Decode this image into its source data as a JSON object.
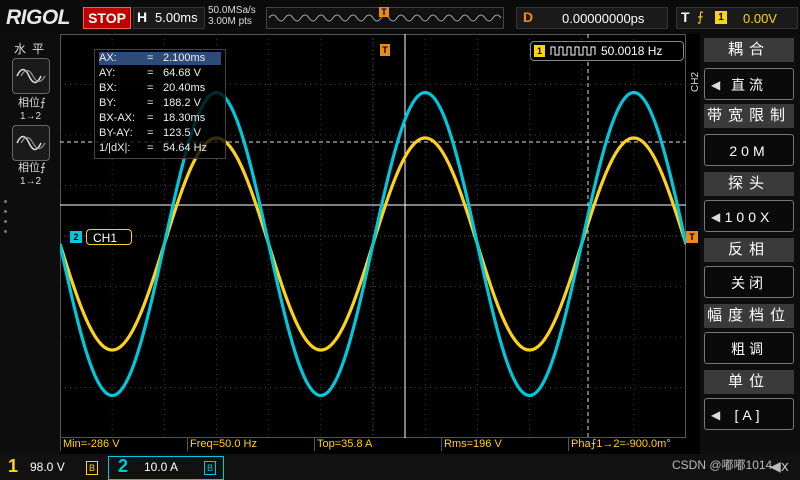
{
  "header": {
    "logo": "RIGOL",
    "run_state": "STOP",
    "horizontal_label": "H",
    "timebase": "5.00ms",
    "sample_rate": "50.0MSa/s",
    "memory_depth": "3.00M pts",
    "trigger_marker": "T",
    "delay_label": "D",
    "delay_value": "0.00000000ps",
    "trigger_label": "T",
    "trigger_edge": "⨍",
    "trigger_source": "1",
    "trigger_level": "0.00V"
  },
  "left_panel": {
    "title": "水平",
    "items": [
      {
        "label": "相位⨍",
        "sub": "1→2"
      },
      {
        "label": "相位⨍",
        "sub": "1→2"
      }
    ]
  },
  "cursor_table": {
    "rows": [
      {
        "k": "AX:",
        "v": "2.100ms"
      },
      {
        "k": "AY:",
        "v": "64.68 V"
      },
      {
        "k": "BX:",
        "v": "20.40ms"
      },
      {
        "k": "BY:",
        "v": "188.2 V"
      },
      {
        "k": "BX-AX:",
        "v": "18.30ms"
      },
      {
        "k": "BY-AY:",
        "v": "123.5 V"
      },
      {
        "k": "1/|dX|:",
        "v": "54.64 Hz"
      }
    ]
  },
  "freq_box": {
    "source": "1",
    "value": "50.0018 Hz"
  },
  "channel_tags": {
    "ch2_marker": "2",
    "ch1_tag": "CH1",
    "trig_right": "T",
    "trig_top": "T"
  },
  "right_menu": {
    "channel": "CH2",
    "items": [
      {
        "head": "耦合",
        "value": "直流"
      },
      {
        "head": "带宽限制",
        "value": "20M"
      },
      {
        "head": "探头",
        "value": "100X"
      },
      {
        "head": "反相",
        "value": "关闭"
      },
      {
        "head": "幅度档位",
        "value": "粗调"
      },
      {
        "head": "单位",
        "value": "[A]"
      }
    ]
  },
  "measurements": [
    "Min=-286 V",
    "Freq=50.0 Hz",
    "Top=35.8 A",
    "Rms=196 V",
    "Pha⨍1→2=-900.0m°"
  ],
  "bottom": {
    "ch1_num": "1",
    "ch1_scale": "98.0 V",
    "ch1_icon": "B",
    "ch2_num": "2",
    "ch2_scale": "10.0 A",
    "ch2_icon": "B",
    "watermark": "CSDN @嘟嘟1014",
    "speaker": "◀ⅹ"
  },
  "colors": {
    "ch1": "#ffd21a",
    "ch2": "#00c8dc",
    "trigger": "#e98a1c",
    "grid": "#3a3a3a"
  },
  "chart_data": {
    "type": "line",
    "xlabel": "",
    "ylabel": "",
    "grid": true,
    "series": [
      {
        "name": "CH1",
        "frequency_hz": 50.0018,
        "peak_divisions": 2.1,
        "phase_deg": 0
      },
      {
        "name": "CH2",
        "frequency_hz": 50.0018,
        "peak_divisions": 3.0,
        "phase_deg": 0
      }
    ]
  }
}
